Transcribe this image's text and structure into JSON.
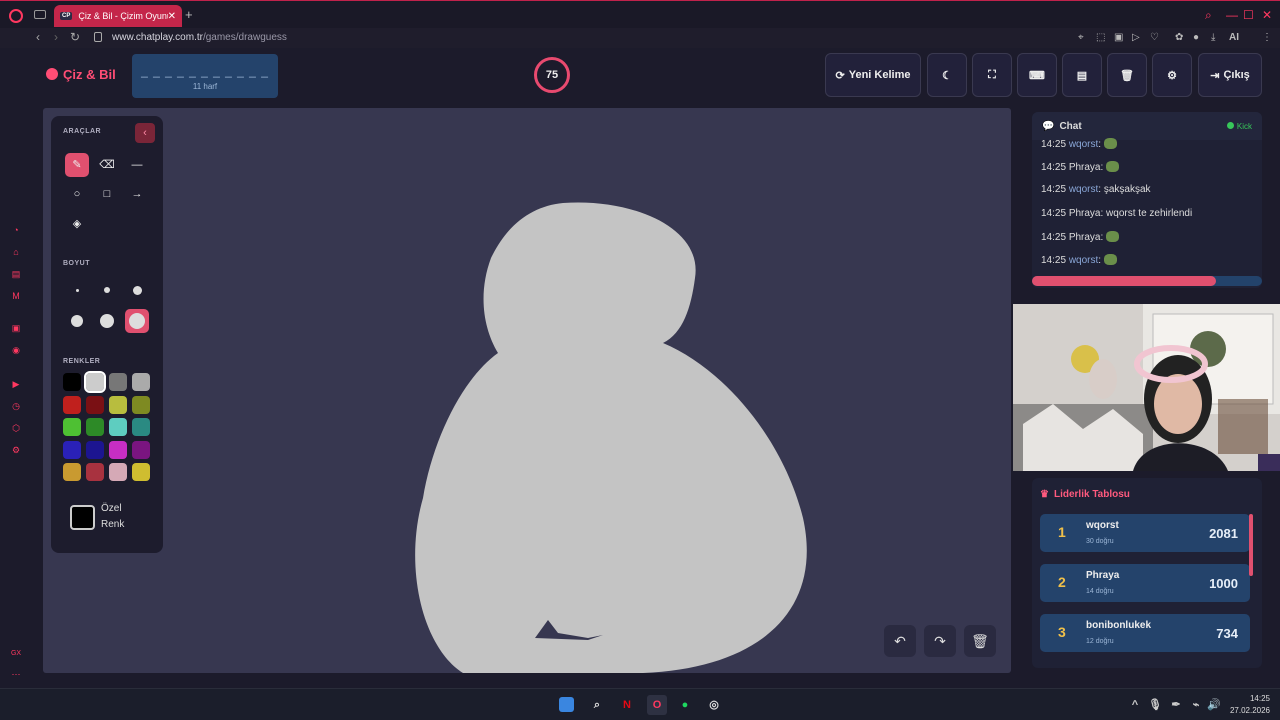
{
  "browser": {
    "tab_title": "Çiz & Bil - Çizim Oyunu",
    "tab_favicon": "CP",
    "url_domain": "www.chatplay.com.tr",
    "url_path": "/games/drawguess",
    "aria_label": "AI"
  },
  "header": {
    "logo_text": "Çiz & Bil",
    "word_blanks": "_ _ _ _ _ _ _ _ _ _ _",
    "word_hint": "11 harf",
    "timer": "75",
    "new_word_label": "Yeni Kelime",
    "exit_label": "Çıkış"
  },
  "toolbox": {
    "tools_label": "ARAÇLAR",
    "size_label": "BOYUT",
    "colors_label": "RENKLER",
    "custom_color_label": "Özel Renk",
    "palette": [
      "#000000",
      "#cccccc",
      "#777777",
      "#aaaaaa",
      "#c0201d",
      "#7a1014",
      "#b8bd3e",
      "#7e8a22",
      "#4ec033",
      "#2d8a27",
      "#5ecdc0",
      "#2a8a82",
      "#2a21b8",
      "#1c1590",
      "#c72ec4",
      "#7a1580",
      "#c99a30",
      "#a8323f",
      "#d5a9b6",
      "#cfbd30"
    ]
  },
  "chat": {
    "title": "Chat",
    "platform": "Kick",
    "messages": [
      {
        "time": "14:25",
        "user": "wqorst",
        "text": ":",
        "emote": true,
        "user_color": "blue"
      },
      {
        "time": "14:25",
        "user": "Phraya",
        "text": ":",
        "emote": true,
        "user_color": "white"
      },
      {
        "time": "14:25",
        "user": "wqorst",
        "text": ": şakşakşak",
        "emote": false,
        "user_color": "blue"
      },
      {
        "time": "14:25",
        "user": "Phraya",
        "text": ": wqorst te zehirlendi",
        "emote": false,
        "user_color": "white"
      },
      {
        "time": "14:25",
        "user": "Phraya",
        "text": ":",
        "emote": true,
        "user_color": "white"
      },
      {
        "time": "14:25",
        "user": "wqorst",
        "text": ":",
        "emote": true,
        "user_color": "blue"
      }
    ],
    "progress": 0.8
  },
  "leaderboard": {
    "title": "Liderlik Tablosu",
    "rows": [
      {
        "rank": "1",
        "name": "wqorst",
        "correct": "30 doğru",
        "score": "2081"
      },
      {
        "rank": "2",
        "name": "Phraya",
        "correct": "14 doğru",
        "score": "1000"
      },
      {
        "rank": "3",
        "name": "bonibonlukek",
        "correct": "12 doğru",
        "score": "734"
      }
    ]
  },
  "taskbar": {
    "time": "14:25",
    "date": "27.02.2026"
  }
}
